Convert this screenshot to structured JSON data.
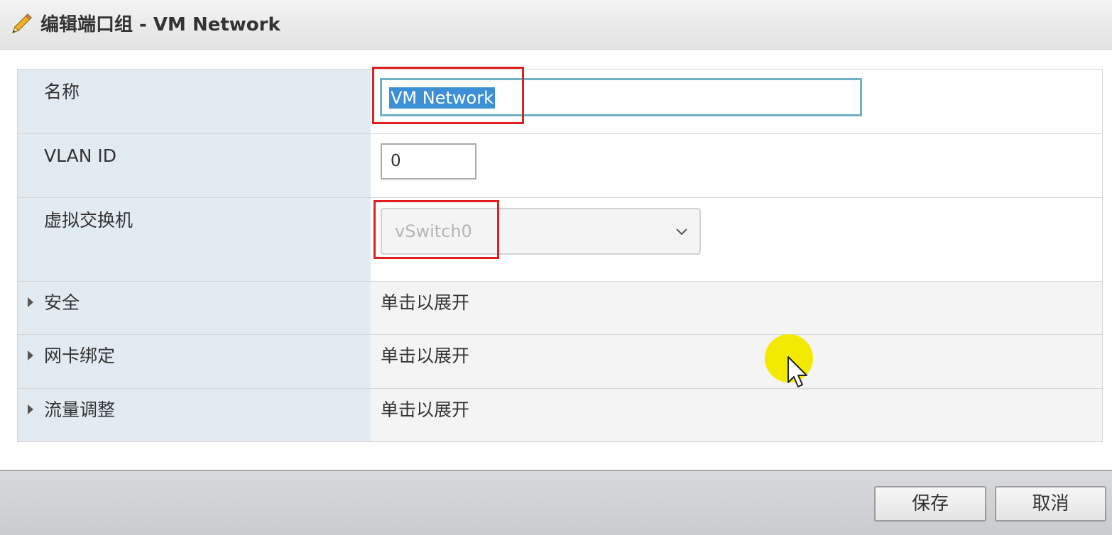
{
  "dialog": {
    "title": "编辑端口组 - VM Network",
    "title_icon": "pencil-icon"
  },
  "form": {
    "name": {
      "label": "名称",
      "value": "VM Network"
    },
    "vlan": {
      "label": "VLAN ID",
      "value": "0"
    },
    "vswitch": {
      "label": "虚拟交换机",
      "value": "vSwitch0",
      "disabled": true
    },
    "sections": [
      {
        "label": "安全",
        "value": "单击以展开"
      },
      {
        "label": "网卡绑定",
        "value": "单击以展开"
      },
      {
        "label": "流量调整",
        "value": "单击以展开"
      }
    ]
  },
  "footer": {
    "save_label": "保存",
    "cancel_label": "取消"
  },
  "colors": {
    "label_background": "#e3ebf2",
    "highlight_box": "#e02020",
    "selection": "#3d8fd6",
    "cursor_highlight": "#f2ea00"
  }
}
